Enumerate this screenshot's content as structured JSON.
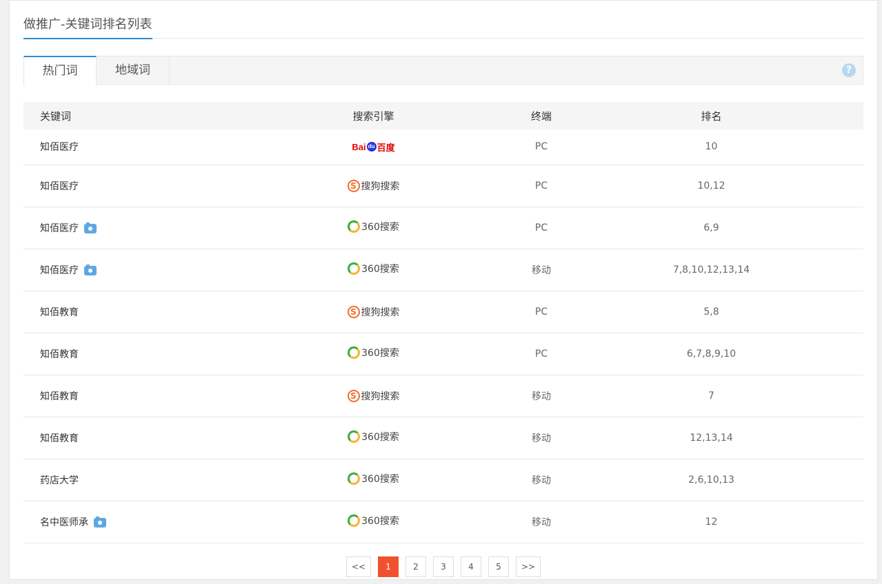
{
  "page": {
    "title": "做推广-关键词排名列表"
  },
  "tabs": [
    {
      "label": "热门词",
      "active": true
    },
    {
      "label": "地域词",
      "active": false
    }
  ],
  "help": {
    "glyph": "?"
  },
  "table": {
    "headers": {
      "keyword": "关键词",
      "engine": "搜索引擎",
      "terminal": "终端",
      "rank": "排名"
    },
    "rows": [
      {
        "keyword": "知佰医疗",
        "camera": false,
        "engine": "baidu",
        "terminal": "PC",
        "rank": "10"
      },
      {
        "keyword": "知佰医疗",
        "camera": false,
        "engine": "sogou",
        "terminal": "PC",
        "rank": "10,12"
      },
      {
        "keyword": "知佰医疗",
        "camera": true,
        "engine": "360",
        "terminal": "PC",
        "rank": "6,9"
      },
      {
        "keyword": "知佰医疗",
        "camera": true,
        "engine": "360",
        "terminal": "移动",
        "rank": "7,8,10,12,13,14"
      },
      {
        "keyword": "知佰教育",
        "camera": false,
        "engine": "sogou",
        "terminal": "PC",
        "rank": "5,8"
      },
      {
        "keyword": "知佰教育",
        "camera": false,
        "engine": "360",
        "terminal": "PC",
        "rank": "6,7,8,9,10"
      },
      {
        "keyword": "知佰教育",
        "camera": false,
        "engine": "sogou",
        "terminal": "移动",
        "rank": "7"
      },
      {
        "keyword": "知佰教育",
        "camera": false,
        "engine": "360",
        "terminal": "移动",
        "rank": "12,13,14"
      },
      {
        "keyword": "药店大学",
        "camera": false,
        "engine": "360",
        "terminal": "移动",
        "rank": "2,6,10,13"
      },
      {
        "keyword": "名中医师承",
        "camera": true,
        "engine": "360",
        "terminal": "移动",
        "rank": "12"
      }
    ]
  },
  "engines": {
    "baidu": {
      "text_a": "Bai",
      "text_paw": "du",
      "text_b": "百度"
    },
    "sogou": {
      "mark": "S",
      "text": "搜狗搜索"
    },
    "360": {
      "text": "360搜索"
    }
  },
  "pagination": {
    "prev": "<<",
    "pages": [
      "1",
      "2",
      "3",
      "4",
      "5"
    ],
    "current": "1",
    "next": ">>"
  },
  "colors": {
    "accent": "#2a8bd4",
    "pager_current": "#f0522f",
    "baidu_red": "#e10602",
    "baidu_blue": "#2932e1",
    "sogou_orange": "#f26b2b",
    "green_360": "#3ab03e",
    "yellow_360": "#f6b52c"
  }
}
